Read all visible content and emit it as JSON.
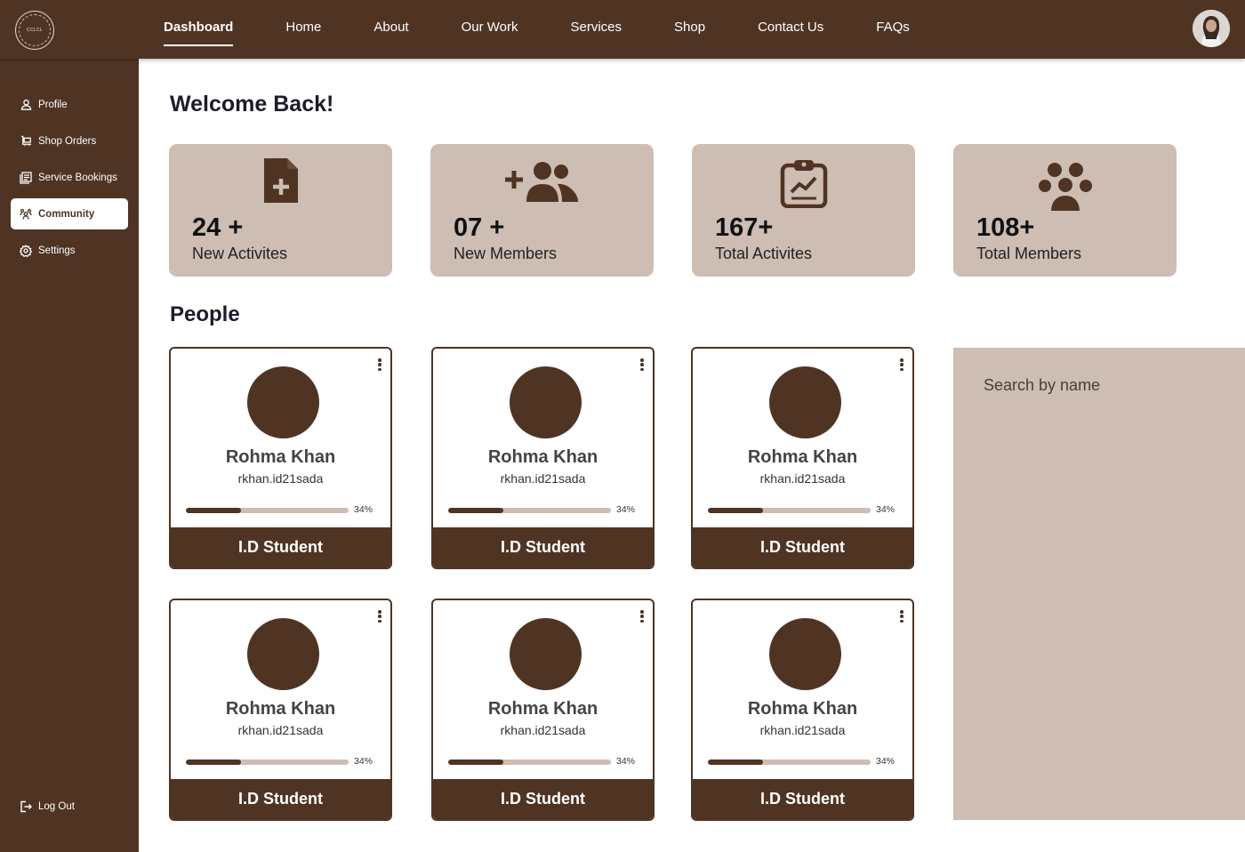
{
  "brand": {
    "logo_text": "CCLCL"
  },
  "nav": {
    "items": [
      {
        "label": "Dashboard",
        "active": true
      },
      {
        "label": "Home"
      },
      {
        "label": "About"
      },
      {
        "label": "Our Work"
      },
      {
        "label": "Services"
      },
      {
        "label": "Shop"
      },
      {
        "label": "Contact Us"
      },
      {
        "label": "FAQs"
      }
    ]
  },
  "sidebar": {
    "items": [
      {
        "label": "Profile",
        "icon": "user-icon"
      },
      {
        "label": "Shop Orders",
        "icon": "cart-icon"
      },
      {
        "label": "Service Bookings",
        "icon": "bookings-icon"
      },
      {
        "label": "Community",
        "icon": "community-icon",
        "active": true
      },
      {
        "label": "Settings",
        "icon": "gear-icon"
      }
    ],
    "logout": {
      "label": "Log Out",
      "icon": "logout-icon"
    }
  },
  "main": {
    "welcome": "Welcome Back!",
    "people_title": "People"
  },
  "stats": [
    {
      "value": "24 +",
      "label": "New Activites",
      "icon": "add-document-icon"
    },
    {
      "value": "07 +",
      "label": "New Members",
      "icon": "add-members-icon"
    },
    {
      "value": "167+",
      "label": "Total Activites",
      "icon": "clipboard-chart-icon"
    },
    {
      "value": "108+",
      "label": "Total Members",
      "icon": "group-icon"
    }
  ],
  "people": [
    {
      "name": "Rohma Khan",
      "handle": "rkhan.id21sada",
      "progress": 0.34,
      "progress_label": "34%",
      "role": "I.D Student"
    },
    {
      "name": "Rohma Khan",
      "handle": "rkhan.id21sada",
      "progress": 0.34,
      "progress_label": "34%",
      "role": "I.D Student"
    },
    {
      "name": "Rohma Khan",
      "handle": "rkhan.id21sada",
      "progress": 0.34,
      "progress_label": "34%",
      "role": "I.D Student"
    },
    {
      "name": "Rohma Khan",
      "handle": "rkhan.id21sada",
      "progress": 0.34,
      "progress_label": "34%",
      "role": "I.D Student"
    },
    {
      "name": "Rohma Khan",
      "handle": "rkhan.id21sada",
      "progress": 0.34,
      "progress_label": "34%",
      "role": "I.D Student"
    },
    {
      "name": "Rohma Khan",
      "handle": "rkhan.id21sada",
      "progress": 0.34,
      "progress_label": "34%",
      "role": "I.D Student"
    }
  ],
  "search": {
    "placeholder": "Search by name"
  },
  "colors": {
    "brand": "#4f3424",
    "card_bg": "#cdbdb3",
    "text_dark": "#1c1c2c"
  }
}
